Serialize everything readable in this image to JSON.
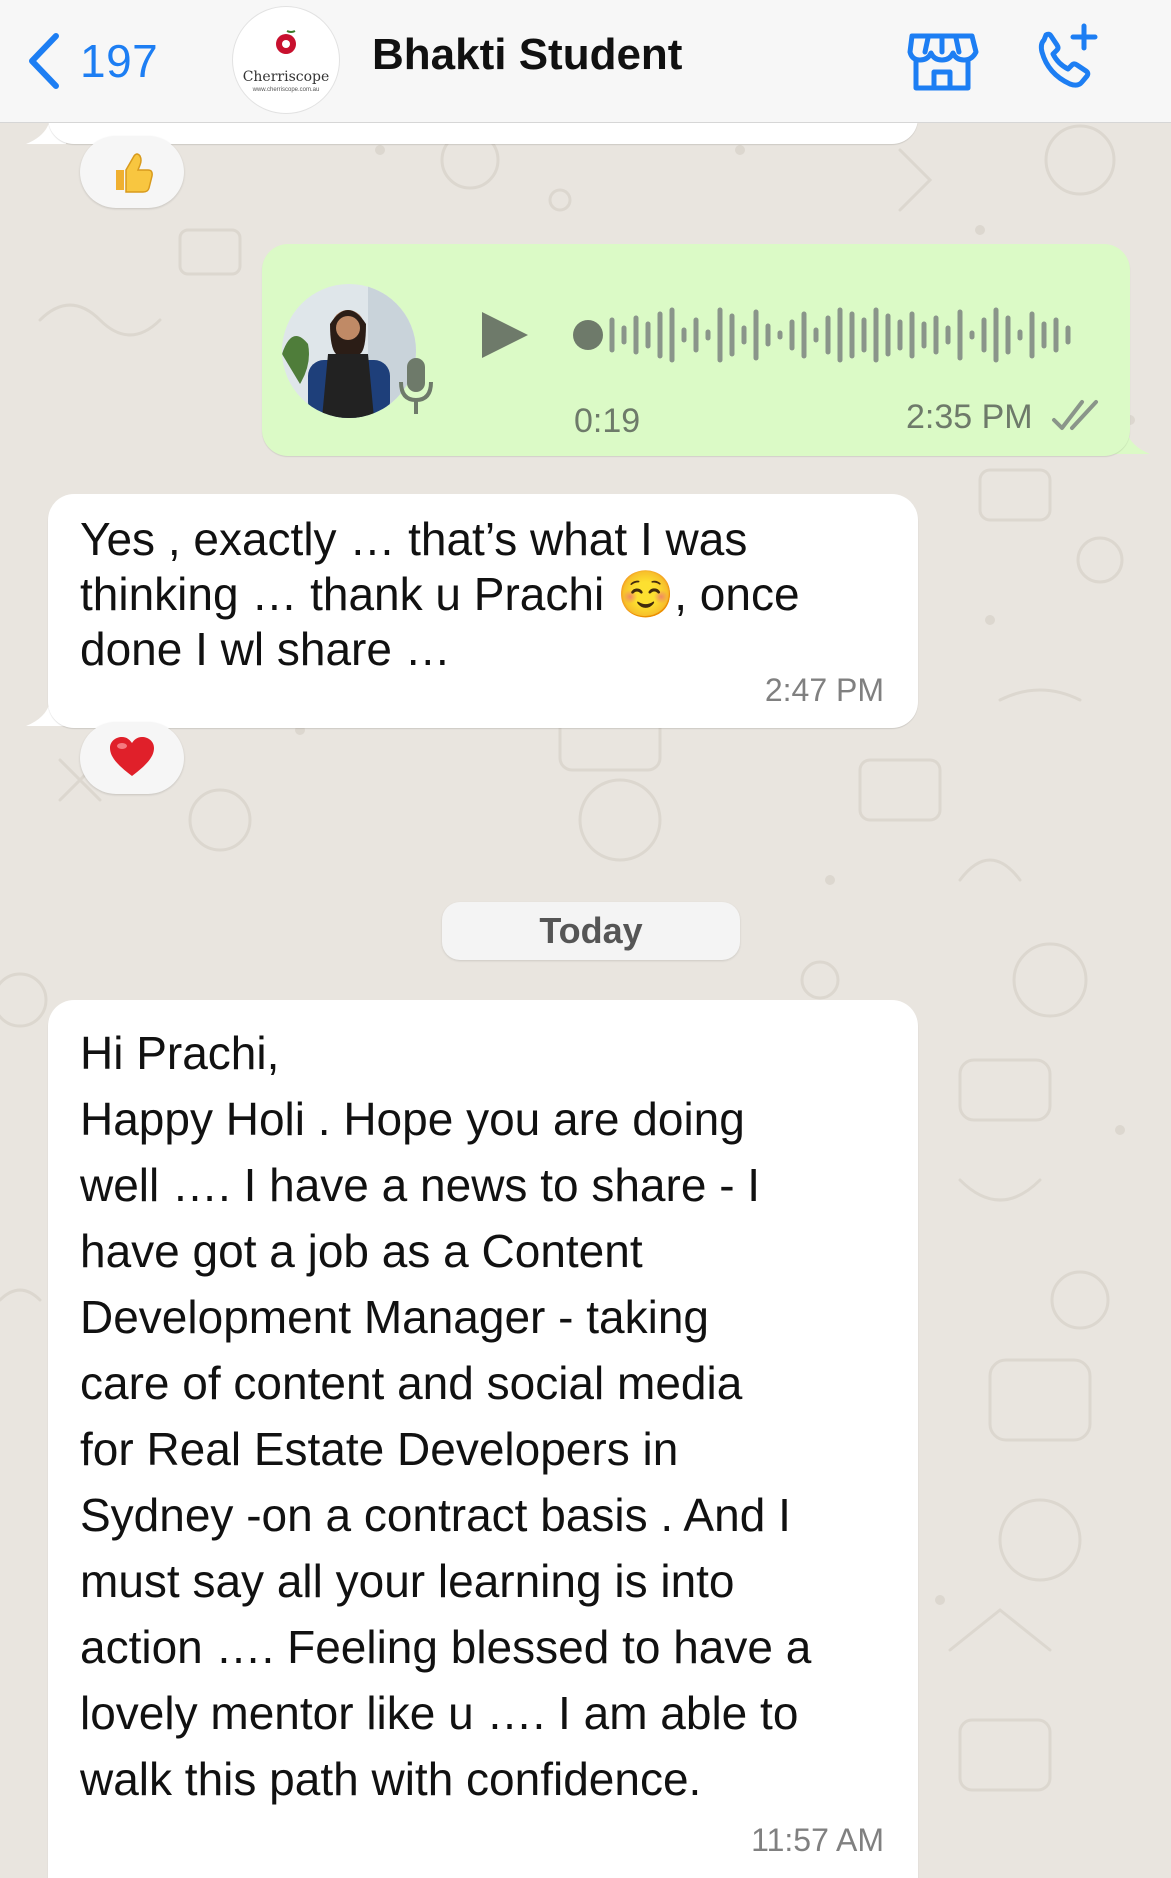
{
  "header": {
    "back_count": "197",
    "contact_name": "Bhakti Student",
    "avatar_brand": "Cherriscope",
    "avatar_brand_url": "www.cherriscope.com.au",
    "icons": [
      "back-chevron-icon",
      "business-store-icon",
      "add-call-icon"
    ]
  },
  "messages": [
    {
      "type": "reaction_only",
      "reaction": "thumbs-up"
    },
    {
      "type": "voice",
      "direction": "outgoing",
      "duration": "0:19",
      "time": "2:35 PM",
      "status": "read"
    },
    {
      "type": "text",
      "direction": "incoming",
      "text": "Yes , exactly … that’s what I was\nthinking … thank u Prachi ☺️, once\ndone I wl share …",
      "time": "2:47 PM",
      "reaction": "red-heart"
    },
    {
      "type": "text",
      "direction": "incoming",
      "text": "Hi Prachi,\nHappy Holi . Hope you are doing\nwell …. I have a news to share - I\nhave got a job as a Content\nDevelopment Manager - taking\ncare of content and social media\nfor Real Estate Developers in\nSydney -on a contract basis . And I\nmust say all your learning is into\naction …. Feeling blessed to have a\nlovely mentor like u …. I am able to\nwalk this path with confidence.",
      "time": "11:57 AM"
    }
  ],
  "date_separator": "Today",
  "colors": {
    "accent": "#1d7ef3",
    "outgoing_bubble": "#dbfac6",
    "incoming_bubble": "#ffffff",
    "wallpaper": "#e9e5df"
  }
}
